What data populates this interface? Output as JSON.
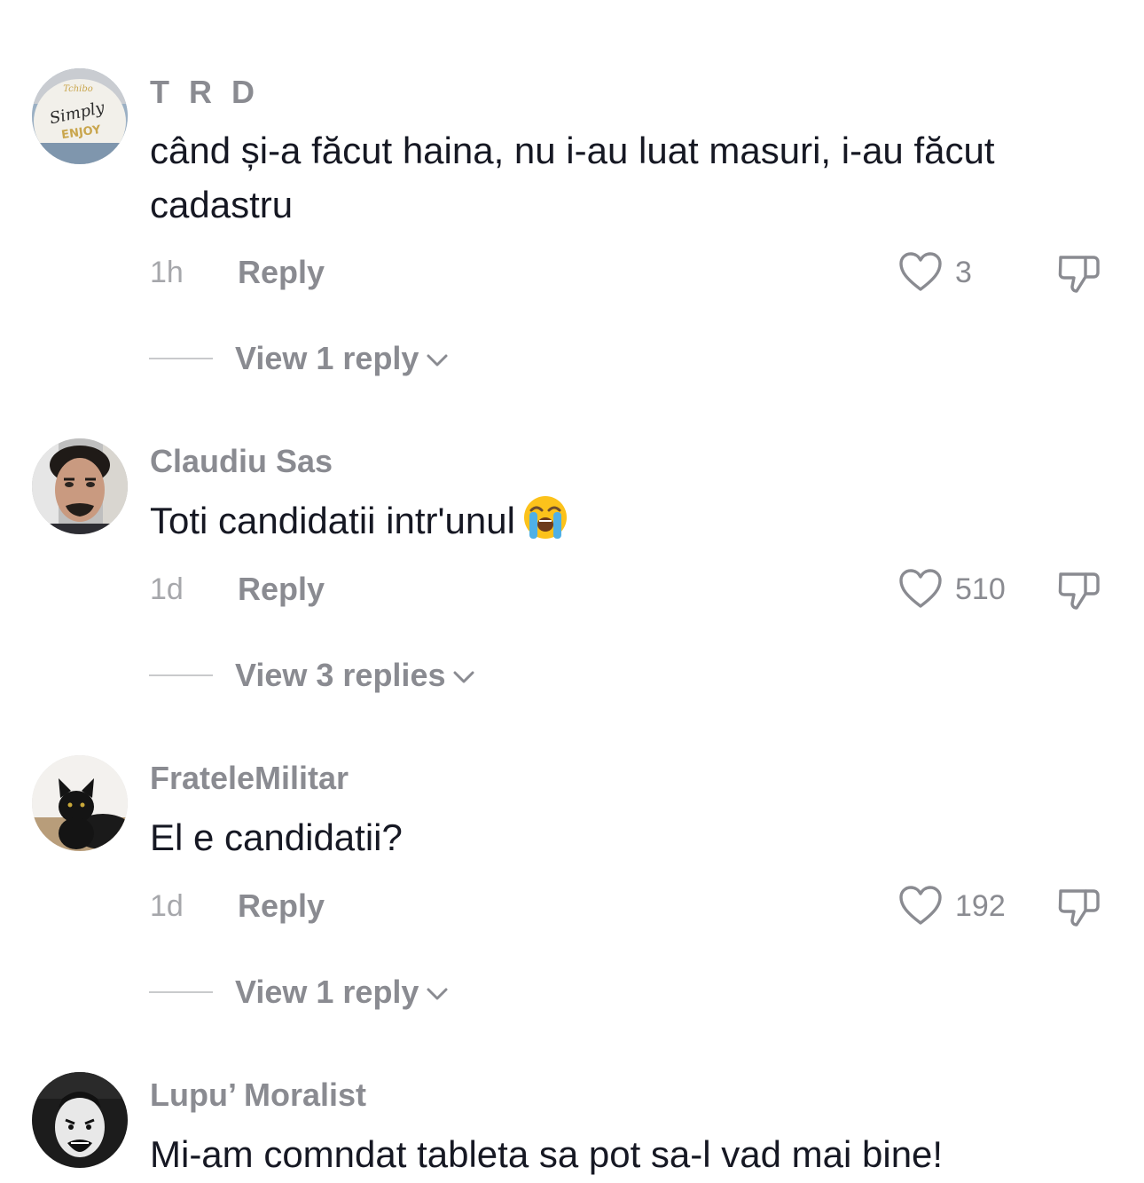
{
  "comments": [
    {
      "username": "T R D",
      "avatar_icon": "avatar-simply-enjoy-cup",
      "text": "când și-a făcut haina, nu i-au luat masuri, i-au făcut cadastru",
      "time": "1h",
      "reply_label": "Reply",
      "likes": "3",
      "view_replies": "View 1 reply"
    },
    {
      "username": "Claudiu Sas",
      "avatar_icon": "avatar-man-photo",
      "text": "Toti candidatii intr'unul",
      "text_emoji": "loudly-crying-face-emoji",
      "time": "1d",
      "reply_label": "Reply",
      "likes": "510",
      "view_replies": "View 3 replies"
    },
    {
      "username": "FrateleMilitar",
      "avatar_icon": "avatar-black-cat",
      "text": "El e candidatii?",
      "time": "1d",
      "reply_label": "Reply",
      "likes": "192",
      "view_replies": "View 1 reply"
    },
    {
      "username": "Lupu’ Moralist",
      "avatar_icon": "avatar-cartoon-face",
      "text": "Mi-am comndat tableta sa pot sa-l vad mai bine!"
    }
  ],
  "icons": {
    "like": "heart-outline-icon",
    "dislike": "thumbs-down-icon",
    "expand": "chevron-down-icon"
  },
  "colors": {
    "text": "#161823",
    "muted": "#8a8b91",
    "background": "#ffffff"
  }
}
